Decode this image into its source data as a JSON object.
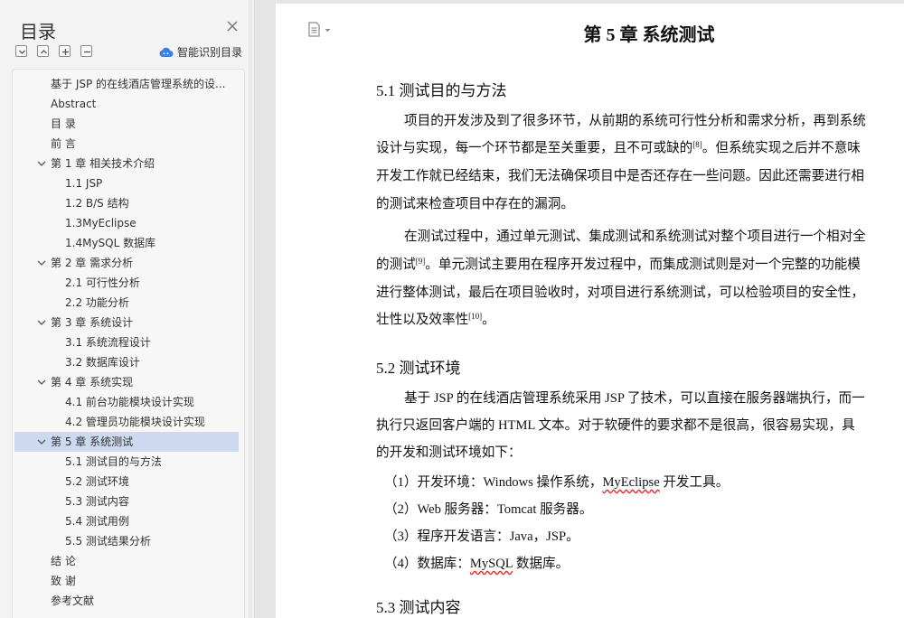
{
  "toc": {
    "title": "目录",
    "smart_toc_label": "智能识别目录",
    "items": [
      {
        "label": "基于 JSP 的在线酒店管理系统的设...",
        "level": 0
      },
      {
        "label": "Abstract",
        "level": 0
      },
      {
        "label": "目 录",
        "level": 0
      },
      {
        "label": "前 言",
        "level": 0
      },
      {
        "label": "第 1 章  相关技术介绍",
        "level": 0,
        "expanded": true
      },
      {
        "label": "1.1 JSP",
        "level": 1
      },
      {
        "label": "1.2  B/S 结构",
        "level": 1
      },
      {
        "label": "1.3MyEclipse",
        "level": 1
      },
      {
        "label": "1.4MySQL 数据库",
        "level": 1
      },
      {
        "label": "第 2 章  需求分析",
        "level": 0,
        "expanded": true
      },
      {
        "label": "2.1 可行性分析",
        "level": 1
      },
      {
        "label": "2.2 功能分析",
        "level": 1
      },
      {
        "label": "第 3 章  系统设计",
        "level": 0,
        "expanded": true
      },
      {
        "label": "3.1 系统流程设计",
        "level": 1
      },
      {
        "label": "3.2 数据库设计",
        "level": 1
      },
      {
        "label": "第 4 章  系统实现",
        "level": 0,
        "expanded": true
      },
      {
        "label": "4.1  前台功能模块设计实现",
        "level": 1
      },
      {
        "label": "4.2  管理员功能模块设计实现",
        "level": 1
      },
      {
        "label": "第 5 章  系统测试",
        "level": 0,
        "expanded": true,
        "selected": true
      },
      {
        "label": "5.1 测试目的与方法",
        "level": 1
      },
      {
        "label": "5.2 测试环境",
        "level": 1
      },
      {
        "label": "5.3 测试内容",
        "level": 1
      },
      {
        "label": "5.4 测试用例",
        "level": 1
      },
      {
        "label": "5.5 测试结果分析",
        "level": 1
      },
      {
        "label": "结 论",
        "level": 0
      },
      {
        "label": "致 谢",
        "level": 0
      },
      {
        "label": "参考文献",
        "level": 0
      }
    ]
  },
  "doc": {
    "chapter_title": "第  5 章  系统测试",
    "s51": {
      "heading": "5.1  测试目的与方法",
      "p1": [
        "项目的开发涉及到了很多环节，从前期的系统可行性分析和需求分析，再到系统",
        "设计与实现，每一个环节都是至关重要，且不可或缺的",
        "[8]",
        "。但系统实现之后并不意味",
        "开发工作就已经结束，我们无法确保项目中是否还存在一些问题。因此还需要进行相",
        "的测试来检查项目中存在的漏洞。"
      ],
      "p2": [
        "在测试过程中，通过单元测试、集成测试和系统测试对整个项目进行一个相对全",
        "的测试",
        "[9]",
        "。单元测试主要用在程序开发过程中，而集成测试则是对一个完整的功能模",
        "进行整体测试，最后在项目验收时，对项目进行系统测试，可以检验项目的安全性，",
        "壮性以及效率性",
        "[10]",
        "。"
      ]
    },
    "s52": {
      "heading": "5.2  测试环境",
      "p1": [
        "基于 JSP 的在线酒店管理系统采用 JSP 了技术，可以直接在服务器端执行，而一",
        "执行只返回客户端的 HTML 文本。对于软硬件的要求都不是很高，很容易实现，具",
        "的开发和测试环境如下："
      ],
      "list": [
        {
          "pre": "（1）开发环境：Windows 操作系统，",
          "wavy": "MyEclipse",
          "post": " 开发工具。"
        },
        {
          "pre": "（2）Web 服务器：Tomcat 服务器。",
          "wavy": "",
          "post": ""
        },
        {
          "pre": "（3）程序开发语言：Java，JSP。",
          "wavy": "",
          "post": ""
        },
        {
          "pre": "（4）数据库：",
          "wavy": "MySQL",
          "post": " 数据库。"
        }
      ]
    },
    "s53": {
      "heading": "5.3  测试内容"
    }
  }
}
